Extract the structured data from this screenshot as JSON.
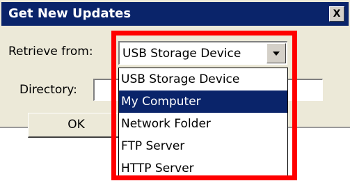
{
  "window": {
    "title": "Get New Updates",
    "close_label": "X"
  },
  "form": {
    "retrieve_label": "Retrieve from:",
    "retrieve_value": "USB Storage Device",
    "directory_label": "Directory:",
    "directory_value": "",
    "ok_label": "OK"
  },
  "dropdown": {
    "options": [
      "USB Storage Device",
      "My Computer",
      "Network Folder",
      "FTP Server",
      "HTTP Server"
    ],
    "selected": "My Computer"
  },
  "colors": {
    "highlight": "#ff0000",
    "title_bar": "#0a246a",
    "selection": "#0a246a"
  }
}
